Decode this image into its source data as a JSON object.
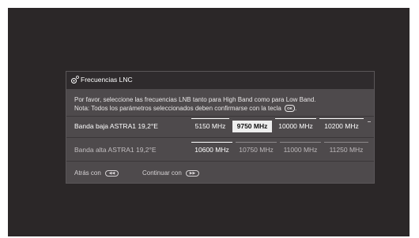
{
  "dialog": {
    "title": "Frecuencias LNC",
    "description_line1": "Por favor, seleccione las frecuencias LNB tanto para High Band como para Low Band.",
    "description_line2": "Nota: Todos los parámetros seleccionados deben confirmarse con la tecla",
    "ok_key_label": "OK",
    "icon": "satellite-settings-icon"
  },
  "rows": [
    {
      "label": "Banda baja ASTRA1 19,2°E",
      "options": [
        "5150 MHz",
        "9750 MHz",
        "10000 MHz",
        "10200 MHz"
      ],
      "selected_index": 1
    },
    {
      "label": "Banda alta ASTRA1 19,2°E",
      "options": [
        "10600 MHz",
        "10750 MHz",
        "11000 MHz",
        "11250 MHz"
      ],
      "selected_index": 0
    }
  ],
  "footer": {
    "back_label": "Atrás con",
    "back_key_icon": "rewind-key-icon",
    "continue_label": "Continuar con",
    "continue_key_icon": "fast-forward-key-icon"
  },
  "colors": {
    "screen_bg": "#2b2728",
    "dialog_bg": "#4e4a4c",
    "header_bg": "#2f2b2d",
    "selected_bg": "#eeeeee"
  }
}
